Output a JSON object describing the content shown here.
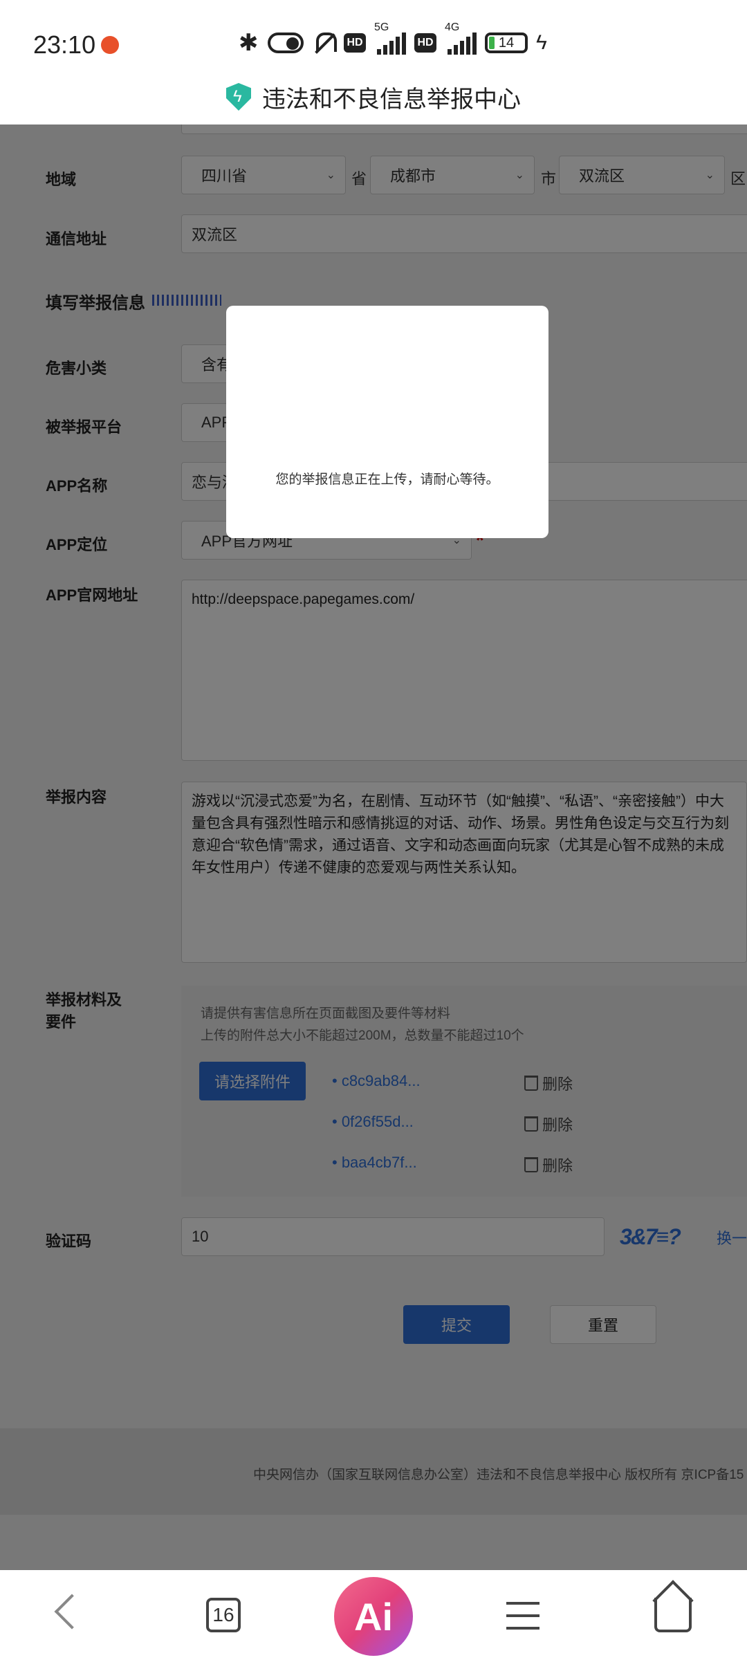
{
  "status_bar": {
    "time": "23:10",
    "net_5g": "5G",
    "net_4g": "4G",
    "hd": "HD",
    "battery": "14"
  },
  "header": {
    "title": "违法和不良信息举报中心"
  },
  "form": {
    "region": {
      "label": "地域",
      "province": "四川省",
      "province_unit": "省",
      "city": "成都市",
      "city_unit": "市",
      "district": "双流区",
      "district_unit": "区"
    },
    "address": {
      "label": "通信地址",
      "value": "双流区"
    },
    "section_title": "填写举报信息",
    "harm_subtype": {
      "label": "危害小类",
      "value": "含有"
    },
    "platform": {
      "label": "被举报平台",
      "value": "APP",
      "required": "*"
    },
    "app_name": {
      "label": "APP名称",
      "value": "恋与深空"
    },
    "app_locate": {
      "label": "APP定位",
      "value": "APP官方网址",
      "required": "*"
    },
    "app_url": {
      "label": "APP官网地址",
      "value": "http://deepspace.papegames.com/"
    },
    "content": {
      "label": "举报内容",
      "value": "游戏以“沉浸式恋爱”为名，在剧情、互动环节（如“触摸”、“私语”、“亲密接触”）中大量包含具有强烈性暗示和感情挑逗的对话、动作、场景。男性角色设定与交互行为刻意迎合“软色情”需求，通过语音、文字和动态画面向玩家（尤其是心智不成熟的未成年女性用户）传递不健康的恋爱观与两性关系认知。"
    },
    "materials": {
      "label_line1": "举报材料及",
      "label_line2": "要件",
      "hint1": "请提供有害信息所在页面截图及要件等材料",
      "hint2": "上传的附件总大小不能超过200M，总数量不能超过10个",
      "choose_button": "请选择附件",
      "files": [
        {
          "name": "• c8c9ab84...",
          "delete": "删除"
        },
        {
          "name": "• 0f26f55d...",
          "delete": "删除"
        },
        {
          "name": "• baa4cb7f...",
          "delete": "删除"
        }
      ]
    },
    "captcha": {
      "label": "验证码",
      "value": "10",
      "image_text": "3&7≡?",
      "refresh": "换一"
    },
    "submit_button": "提交",
    "reset_button": "重置"
  },
  "footer": {
    "text": "中央网信办（国家互联网信息办公室）违法和不良信息举报中心 版权所有 京ICP备15"
  },
  "dialog": {
    "message": "您的举报信息正在上传，请耐心等待。"
  },
  "bottom_nav": {
    "tab_count": "16",
    "ai_label": "Ai"
  },
  "colors": {
    "accent": "#2f6fd6",
    "required": "#cc0000",
    "shield": "#2ab8a0"
  }
}
